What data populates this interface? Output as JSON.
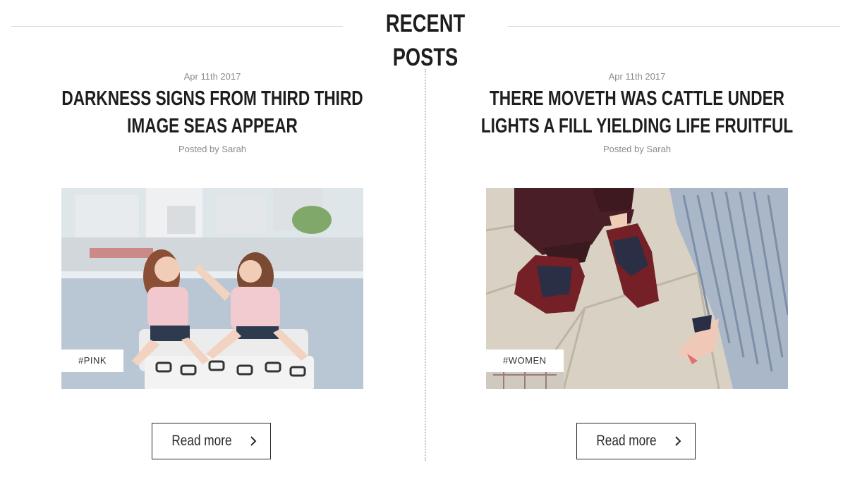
{
  "section": {
    "title": "RECENT POSTS"
  },
  "posts": [
    {
      "date": "Apr 11th 2017",
      "title": "DARKNESS SIGNS FROM THIRD THIRD IMAGE SEAS APPEAR",
      "author": "Posted by Sarah",
      "tag": "#PINK",
      "read_more": "Read more",
      "image": "photo of two women in pink shirts on a rooftop ottoman"
    },
    {
      "date": "Apr 11th 2017",
      "title": "THERE MOVETH WAS CATTLE UNDER LIGHTS A FILL YIELDING LIFE FRUITFUL",
      "author": "Posted by Sarah",
      "tag": "#WOMEN",
      "read_more": "Read more",
      "image": "photo of burgundy brogue shoes and a pleated skirt on paving"
    }
  ],
  "colors": {
    "text": "#1e1e1e",
    "muted": "#8a8a8a",
    "line": "#dcdcdc"
  },
  "icons": {
    "read_more": "chevron-right-icon"
  }
}
